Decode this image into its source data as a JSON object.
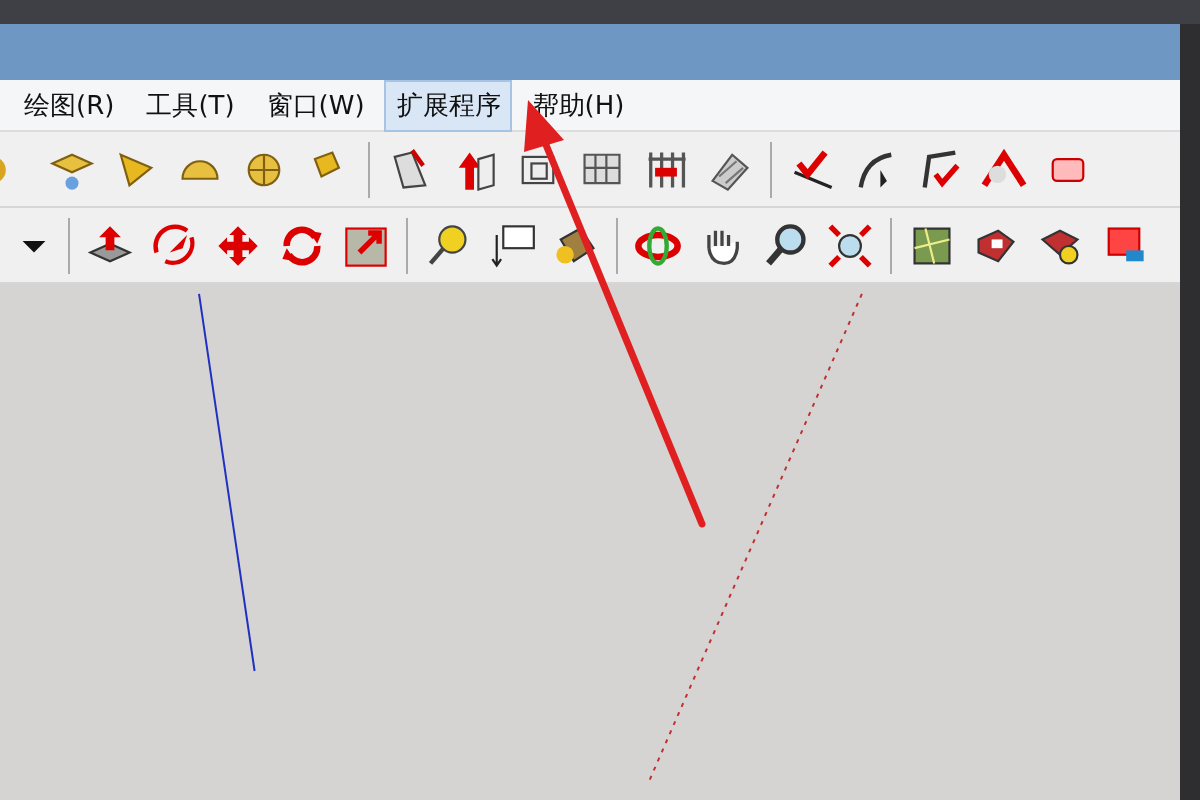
{
  "menu": [
    {
      "label": "绘图(R)",
      "selected": false
    },
    {
      "label": "工具(T)",
      "selected": false
    },
    {
      "label": "窗口(W)",
      "selected": false
    },
    {
      "label": "扩展程序",
      "selected": true
    },
    {
      "label": "帮助(H)",
      "selected": false
    }
  ]
}
